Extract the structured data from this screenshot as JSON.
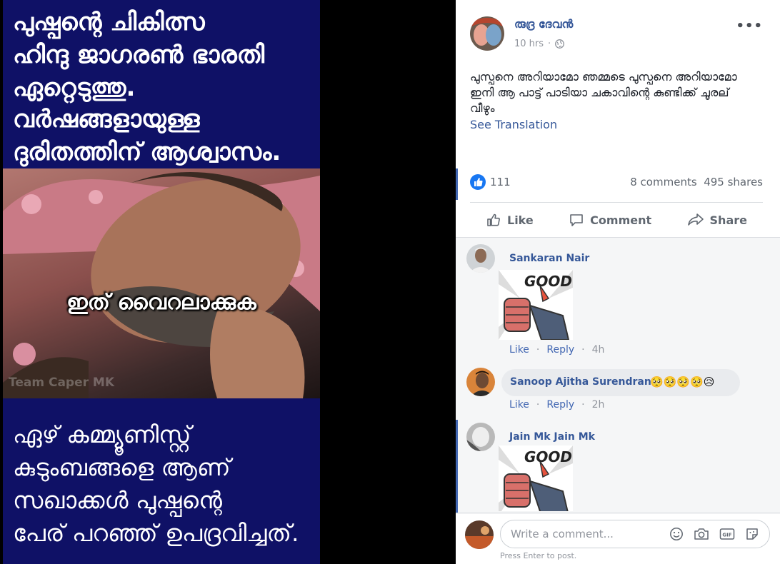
{
  "meme": {
    "top_lines": [
      "പുഷ്പന്റെ ചികിത്സ",
      "ഹിന്ദു ജാഗരൺ ഭാരതി",
      "ഏറ്റെടുത്തു.",
      "വർഷങ്ങളായുള്ള",
      "ദുരിതത്തിന് ആശ്വാസം."
    ],
    "caption": "ഇത് വൈറലാക്കുക",
    "watermark": "Team Caper MK",
    "bottom_lines": [
      "ഏഴ് കമ്മ്യൂണിസ്റ്റ്",
      "കുടുംബങ്ങളെ ആണ്",
      "സഖാക്കൾ പുഷ്പന്റെ",
      "പേര് പറഞ്ഞ് ഉപദ്രവിച്ചത്."
    ]
  },
  "post": {
    "author": "രുദ്ര ദേവൻ",
    "time": "10 hrs",
    "more": "•••",
    "text": "പുസ്പനെ അറിയാമോ ഞമ്മടെ പുസ്പനെ അറിയാമോ ഇനി ആ പാട്ട് പാടിയാ ചകാവിന്റെ കുണ്ടിക്ക് ചൂരല് വീഴും",
    "see_translation": "See Translation",
    "likes": "111",
    "comments_count": "8 comments",
    "shares_count": "495 shares",
    "actions": {
      "like": "Like",
      "comment": "Comment",
      "share": "Share"
    }
  },
  "comments": [
    {
      "name": "Sankaran Nair",
      "sticker_text": "GOOD",
      "like": "Like",
      "reply": "Reply",
      "time": "4h"
    },
    {
      "name": "Sanoop Ajitha Surendran",
      "text": "🥺🥺🥺🥺😥",
      "like": "Like",
      "reply": "Reply",
      "time": "2h"
    },
    {
      "name": "Jain Mk Jain Mk",
      "sticker_text": "GOOD"
    }
  ],
  "composer": {
    "placeholder": "Write a comment...",
    "hint": "Press Enter to post.",
    "icons": [
      "emoji-icon",
      "camera-icon",
      "gif-icon",
      "sticker-icon"
    ]
  },
  "colors": {
    "link": "#365899",
    "like_blue": "#1877f2",
    "meme_bg": "#0f1166"
  }
}
